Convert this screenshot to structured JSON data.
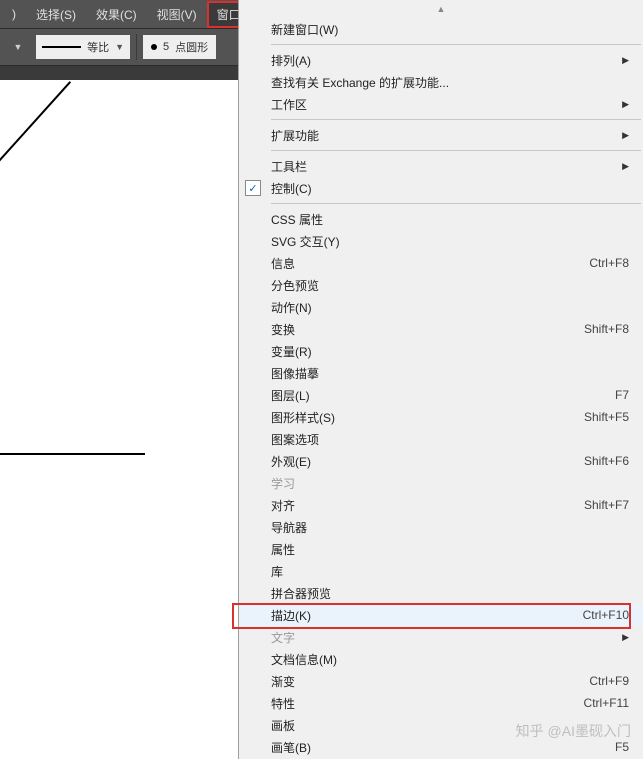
{
  "menubar": {
    "items": [
      {
        "label": ")"
      },
      {
        "label": "选择(S)"
      },
      {
        "label": "效果(C)"
      },
      {
        "label": "视图(V)"
      },
      {
        "label": "窗口(W)",
        "active": true
      }
    ]
  },
  "toolbar": {
    "stroke_label": "等比",
    "cap_value": "5",
    "cap_label": "点圆形"
  },
  "menu": {
    "items": [
      {
        "type": "item",
        "label": "新建窗口(W)"
      },
      {
        "type": "sep"
      },
      {
        "type": "item",
        "label": "排列(A)",
        "submenu": true
      },
      {
        "type": "item",
        "label": "查找有关 Exchange 的扩展功能..."
      },
      {
        "type": "item",
        "label": "工作区",
        "submenu": true
      },
      {
        "type": "sep"
      },
      {
        "type": "item",
        "label": "扩展功能",
        "submenu": true
      },
      {
        "type": "sep"
      },
      {
        "type": "item",
        "label": "工具栏",
        "submenu": true
      },
      {
        "type": "item",
        "label": "控制(C)",
        "checked": true
      },
      {
        "type": "sep"
      },
      {
        "type": "item",
        "label": "CSS 属性"
      },
      {
        "type": "item",
        "label": "SVG 交互(Y)"
      },
      {
        "type": "item",
        "label": "信息",
        "shortcut": "Ctrl+F8"
      },
      {
        "type": "item",
        "label": "分色预览"
      },
      {
        "type": "item",
        "label": "动作(N)"
      },
      {
        "type": "item",
        "label": "变换",
        "shortcut": "Shift+F8"
      },
      {
        "type": "item",
        "label": "变量(R)"
      },
      {
        "type": "item",
        "label": "图像描摹"
      },
      {
        "type": "item",
        "label": "图层(L)",
        "shortcut": "F7"
      },
      {
        "type": "item",
        "label": "图形样式(S)",
        "shortcut": "Shift+F5"
      },
      {
        "type": "item",
        "label": "图案选项"
      },
      {
        "type": "item",
        "label": "外观(E)",
        "shortcut": "Shift+F6"
      },
      {
        "type": "item",
        "label": "学习",
        "disabled": true
      },
      {
        "type": "item",
        "label": "对齐",
        "shortcut": "Shift+F7"
      },
      {
        "type": "item",
        "label": "导航器"
      },
      {
        "type": "item",
        "label": "属性"
      },
      {
        "type": "item",
        "label": "库"
      },
      {
        "type": "item",
        "label": "拼合器预览"
      },
      {
        "type": "item",
        "label": "描边(K)",
        "shortcut": "Ctrl+F10",
        "highlighted": true
      },
      {
        "type": "item",
        "label": "文字",
        "submenu": true,
        "disabled": true
      },
      {
        "type": "item",
        "label": "文档信息(M)"
      },
      {
        "type": "item",
        "label": "渐变",
        "shortcut": "Ctrl+F9"
      },
      {
        "type": "item",
        "label": "特性",
        "shortcut": "Ctrl+F11"
      },
      {
        "type": "item",
        "label": "画板"
      },
      {
        "type": "item",
        "label": "画笔(B)",
        "shortcut": "F5"
      }
    ]
  },
  "watermark": "知乎 @AI墨砚入门"
}
